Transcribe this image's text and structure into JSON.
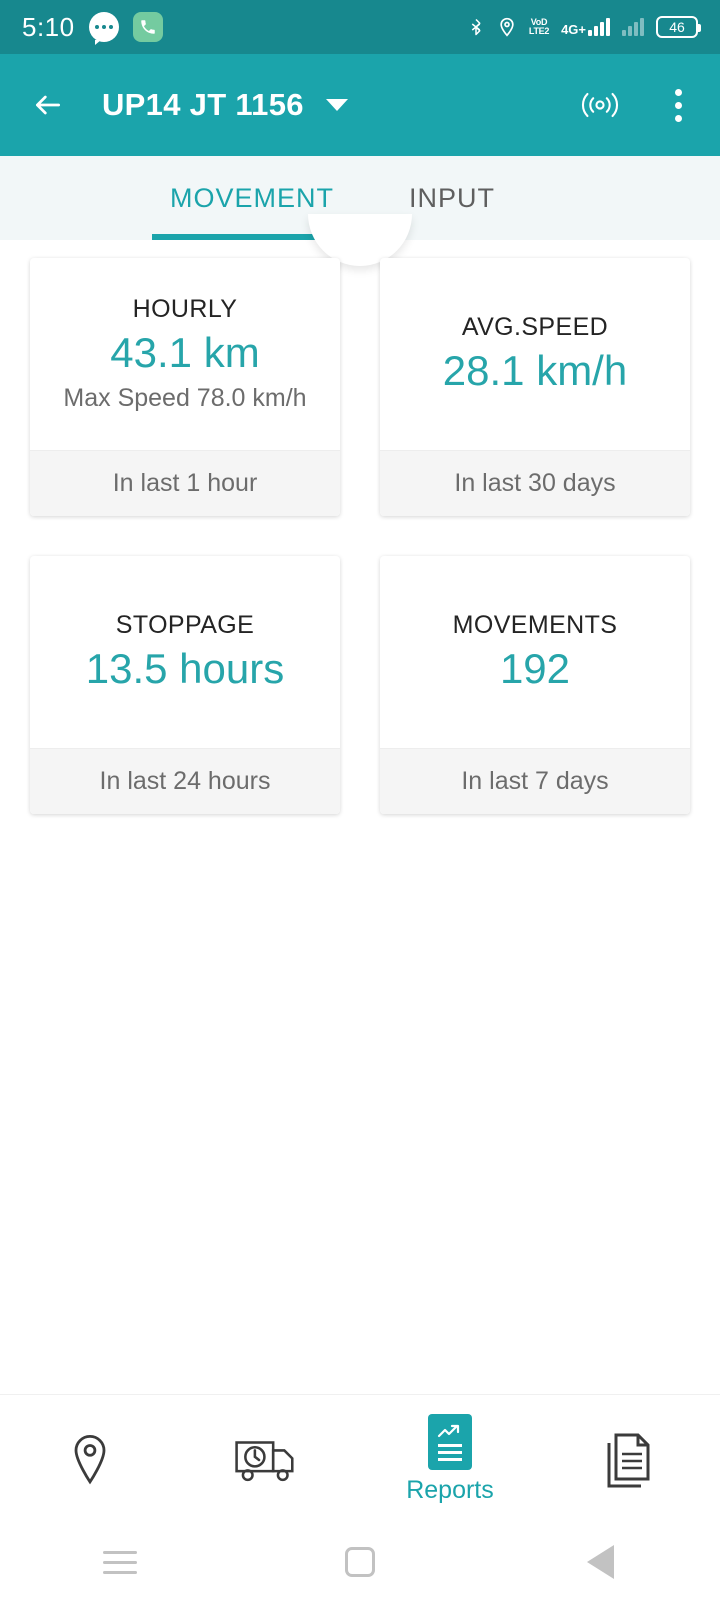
{
  "status_bar": {
    "time": "5:10",
    "icons": [
      "chat-bubble-icon",
      "phone-icon",
      "bluetooth-icon",
      "location-icon",
      "volte-icon",
      "network-4g-icon",
      "signal-bars-icon",
      "battery-icon"
    ],
    "volte_top": "VoD",
    "volte_bottom": "LTE2",
    "network_label": "4G+",
    "battery_level": "46"
  },
  "app_bar": {
    "back_label": "back-arrow",
    "title": "UP14 JT 1156",
    "dropdown": "chevron-down-icon",
    "broadcast": "broadcast-icon",
    "overflow": "overflow-menu-icon"
  },
  "tabs": [
    {
      "label": "MOVEMENT",
      "active": true
    },
    {
      "label": "INPUT",
      "active": false
    }
  ],
  "cards": [
    {
      "title": "HOURLY",
      "value": "43.1 km",
      "subtitle": "Max Speed 78.0 km/h",
      "footer": "In last 1 hour"
    },
    {
      "title": "AVG.SPEED",
      "value": "28.1 km/h",
      "subtitle": "",
      "footer": "In last 30 days"
    },
    {
      "title": "STOPPAGE",
      "value": "13.5 hours",
      "subtitle": "",
      "footer": "In last 24 hours"
    },
    {
      "title": "MOVEMENTS",
      "value": "192",
      "subtitle": "",
      "footer": "In last 7 days"
    }
  ],
  "bottom_nav": [
    {
      "icon": "location-pin-icon",
      "label": "",
      "active": false
    },
    {
      "icon": "truck-clock-icon",
      "label": "",
      "active": false
    },
    {
      "icon": "reports-icon",
      "label": "Reports",
      "active": true
    },
    {
      "icon": "documents-icon",
      "label": "",
      "active": false
    }
  ],
  "system_nav": [
    {
      "icon": "recents-icon"
    },
    {
      "icon": "home-icon"
    },
    {
      "icon": "back-icon"
    }
  ],
  "colors": {
    "status_bar": "#17888e",
    "app_bar": "#1ba4ab",
    "accent": "#1ba4ab",
    "value_text": "#27a5aa",
    "tab_bg": "#f2f7f8",
    "card_footer_bg": "#f5f5f5"
  }
}
